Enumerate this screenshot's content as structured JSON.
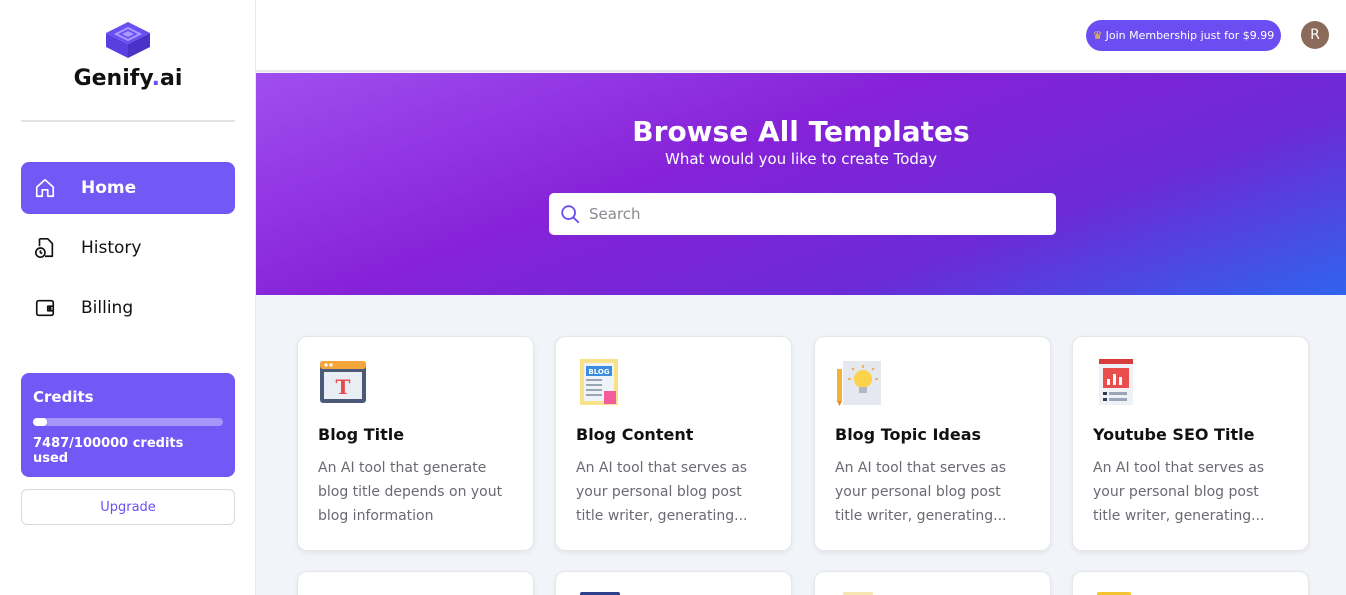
{
  "brand": {
    "name": "Genify",
    "dot": ".",
    "suffix": "ai"
  },
  "sidebar": {
    "items": [
      {
        "label": "Home",
        "icon": "home-icon",
        "active": true
      },
      {
        "label": "History",
        "icon": "history-file-icon",
        "active": false
      },
      {
        "label": "Billing",
        "icon": "wallet-icon",
        "active": false
      }
    ],
    "credits": {
      "title": "Credits",
      "used": 7487,
      "total": 100000,
      "text": "7487/100000 credits used"
    },
    "upgrade_label": "Upgrade"
  },
  "header": {
    "membership_label": "Join Membership just for $9.99",
    "membership_icon": "crown-icon",
    "avatar_initial": "R"
  },
  "hero": {
    "title": "Browse All Templates",
    "subtitle": "What would you like to create Today",
    "search_placeholder": "Search"
  },
  "templates": [
    {
      "title": "Blog Title",
      "desc": "An AI tool that generate blog title depends on yout blog information",
      "icon": "browser-text-icon"
    },
    {
      "title": "Blog Content",
      "desc": "An AI tool that serves as your personal blog post title writer, generating...",
      "icon": "blog-document-icon"
    },
    {
      "title": "Blog Topic Ideas",
      "desc": "An AI tool that serves as your personal blog post title writer, generating...",
      "icon": "lightbulb-idea-icon"
    },
    {
      "title": "Youtube SEO Title",
      "desc": "An AI tool that serves as your personal blog post title writer, generating...",
      "icon": "seo-report-icon"
    }
  ],
  "colors": {
    "primary": "#7258f5",
    "accent": "#6b4ef2",
    "hero_start": "#a04ef0",
    "hero_end": "#2f64ee"
  }
}
